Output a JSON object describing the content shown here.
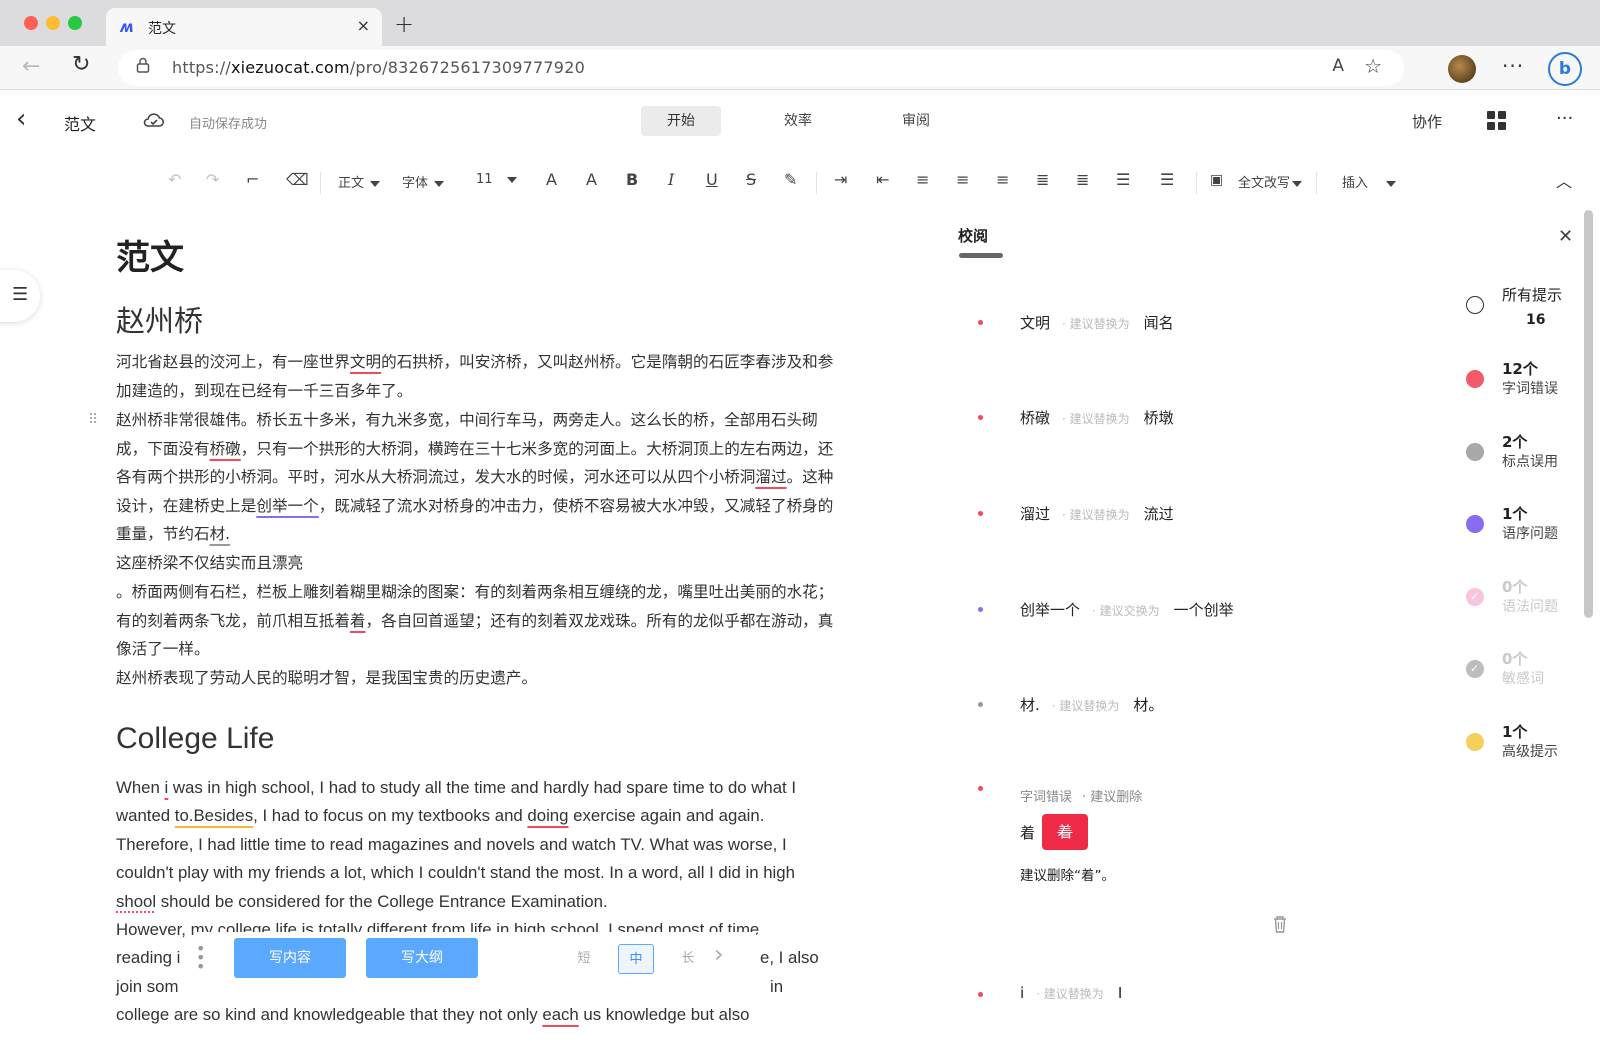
{
  "browser": {
    "tab_title": "范文",
    "tab_logo": "ʍ",
    "tab_close": "×",
    "new_tab": "+",
    "url_prefix": "https://",
    "url_domain": "xiezuocat.com",
    "url_path": "/pro/8326725617309777920"
  },
  "header": {
    "doc_name": "范文",
    "save_status": "自动保存成功",
    "tabs": [
      "开始",
      "效率",
      "审阅"
    ],
    "collab": "协作"
  },
  "toolbar": {
    "style_select": "正文",
    "font_select": "字体",
    "size_select": "11",
    "rewrite": "全文改写",
    "insert": "插入"
  },
  "document": {
    "title": "范文",
    "section1_heading": "赵州桥",
    "p1": [
      "河北省赵县的洨河上，有一座世界",
      "文明",
      "的石拱桥，叫安济桥，又叫赵州桥。它是隋朝的石匠李春涉及和参加建造的，到现在已经有一千三百多年了。"
    ],
    "p2": [
      "赵州桥非常很雄伟。桥长五十多米，有九米多宽，中间行车马，两旁走人。这么长的桥，全部用石头砌成，下面没有",
      "桥礅",
      "，只有一个拱形的大桥洞，横跨在三十七米多宽的河面上。大桥洞顶上的左右两边，还各有两个拱形的小桥洞。平时，河水从大桥洞流过，发大水的时候，河水还可以从四个小桥洞",
      "溜过",
      "。这种设计，在建桥史上是",
      "创举一个",
      "，既减轻了流水对桥身的冲击力，使桥不容易被大水冲毁，又减轻了桥身的重量，节约石",
      "材.",
      ""
    ],
    "p3": "这座桥梁不仅结实而且漂亮",
    "p4": [
      "。桥面两侧有石栏，栏板上雕刻着糊里糊涂的图案：有的刻着两条相互缠绕的龙，嘴里吐出美丽的水花；有的刻着两条飞龙，前爪相互抵着",
      "着",
      "，各自回首遥望；还有的刻着双龙戏珠。所有的龙似乎都在游动，真像活了一样。"
    ],
    "p5": "赵州桥表现了劳动人民的聪明才智，是我国宝贵的历史遗产。",
    "section2_heading": "College Life",
    "e1": [
      "When ",
      "i",
      " was in high school, I had to study all the time and hardly had spare time to do what I wanted ",
      "to.Besides",
      ", I had to focus on my textbooks and ",
      "doing",
      " exercise again and again. Therefore, I had little time to read magazines and novels and watch TV. What was worse, I couldn't play with my friends a lot, which I couldn't stand the most. In a word, all I did in high ",
      "shool",
      " should be considered for the College Entrance Examination."
    ],
    "e2_visible_start": "However, my college life is totally different from life in high school. I spend most of time",
    "e2_line2_start": "reading i",
    "e2_line2_end": "e, I also",
    "e2_line3_start": "join som",
    "e2_line3_end": "in",
    "e2_line4": [
      "college are so kind and knowledgeable that they not only ",
      "each",
      " us knowledge but also"
    ]
  },
  "writebar": {
    "write_content": "写内容",
    "write_outline": "写大纲",
    "short": "短",
    "medium": "中",
    "long": "长"
  },
  "review": {
    "tab": "校阅",
    "suggestions": [
      {
        "word": "文明",
        "hint": "· 建议替换为",
        "replacement": "闻名",
        "color": "#f04b5c"
      },
      {
        "word": "桥礅",
        "hint": "· 建议替换为",
        "replacement": "桥墩",
        "color": "#f04b5c"
      },
      {
        "word": "溜过",
        "hint": "· 建议替换为",
        "replacement": "流过",
        "color": "#f04b5c"
      },
      {
        "word": "创举一个",
        "hint": "· 建议交换为",
        "replacement": "一个创举",
        "color": "#8b6cf0"
      },
      {
        "word": "材.",
        "hint": "· 建议替换为",
        "replacement": "材。",
        "color": "#999999"
      }
    ],
    "expanded": {
      "category": "字词错误",
      "action": "· 建议删除",
      "context_word": "着",
      "deleted_word": "着",
      "note": "建议删除“着”。"
    },
    "last": {
      "word": "i",
      "hint": "· 建议替换为",
      "replacement": "I"
    }
  },
  "categories": [
    {
      "count": "所有提示",
      "label": "16",
      "color": "#ffffff",
      "muted": false
    },
    {
      "count": "12个",
      "label": "字词错误",
      "color": "#f25b68",
      "muted": false
    },
    {
      "count": "2个",
      "label": "标点误用",
      "color": "#a8a8a8",
      "muted": false
    },
    {
      "count": "1个",
      "label": "语序问题",
      "color": "#8b6cf0",
      "muted": false
    },
    {
      "count": "0个",
      "label": "语法问题",
      "color": "#f7c5dd",
      "muted": true
    },
    {
      "count": "0个",
      "label": "敏感词",
      "color": "#c4c4c4",
      "muted": true
    },
    {
      "count": "1个",
      "label": "高级提示",
      "color": "#f5cf5c",
      "muted": false
    }
  ]
}
